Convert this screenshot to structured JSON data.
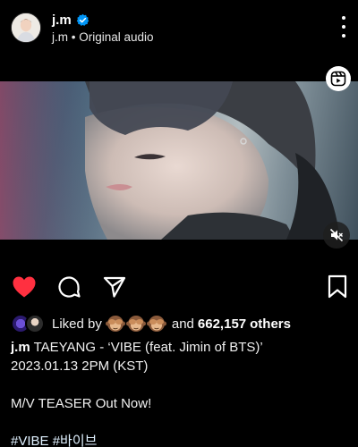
{
  "header": {
    "username": "j.m",
    "subtitle_user": "j.m",
    "subtitle_sep": "•",
    "subtitle_audio": "Original audio"
  },
  "media": {
    "type": "video",
    "muted": true
  },
  "actions": {
    "liked": true,
    "like_color": "#ff3040"
  },
  "likes": {
    "liked_by_label": "Liked by",
    "and_label": "and",
    "count": "662,157",
    "others_label": "others"
  },
  "caption": {
    "username": "j.m",
    "line1": "TAEYANG - ‘VIBE (feat. Jimin of BTS)’",
    "line2": "2023.01.13 2PM (KST)",
    "line3": "M/V TEASER Out Now!",
    "hashtags": "#VIBE #바이브"
  },
  "icons": {
    "verified": "verified-badge-icon",
    "more": "more-options-icon",
    "reels": "reels-icon",
    "mute": "speaker-muted-icon",
    "like": "heart-icon",
    "comment": "comment-icon",
    "share": "send-icon",
    "save": "bookmark-icon"
  },
  "colors": {
    "background": "#000000",
    "verified_blue": "#0095f6",
    "heart_red": "#ff3040"
  }
}
